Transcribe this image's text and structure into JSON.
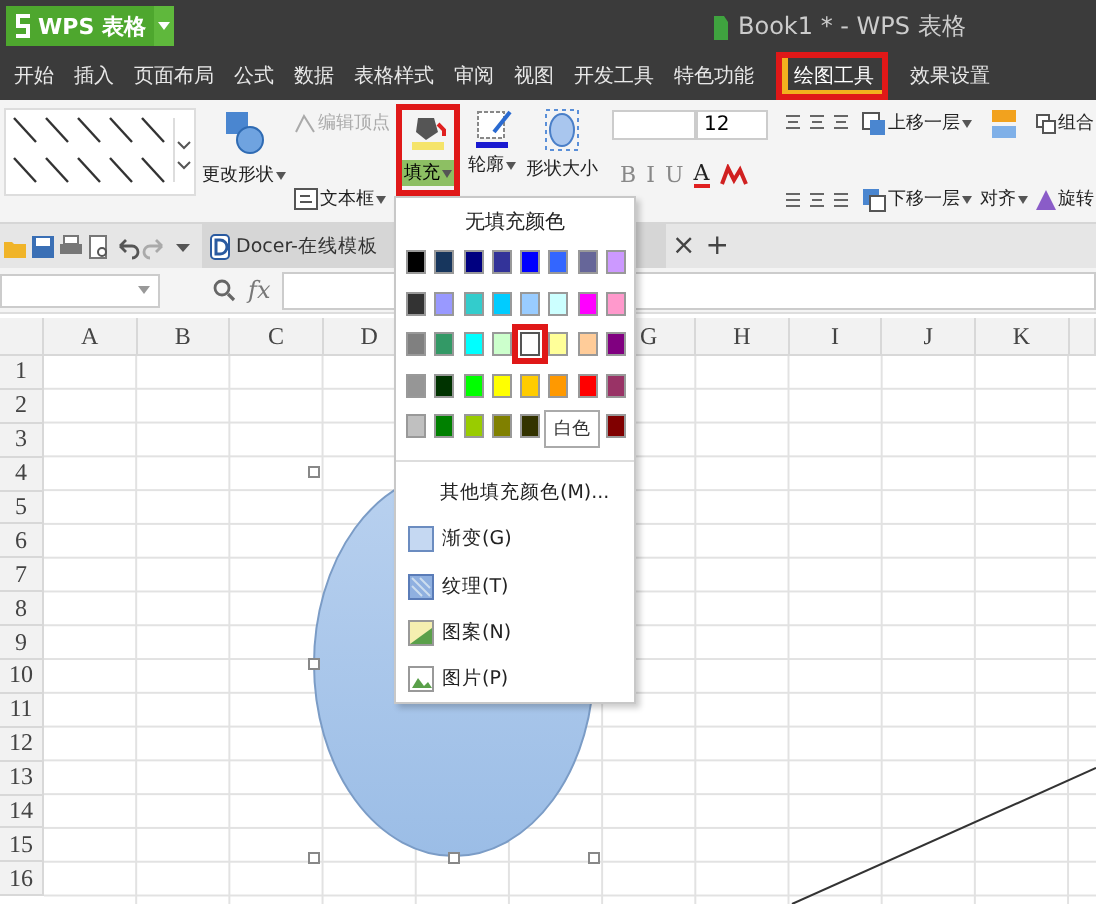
{
  "app_button": {
    "label": "WPS 表格"
  },
  "window": {
    "title": "Book1 * - WPS 表格"
  },
  "menu_tabs": [
    {
      "label": "开始",
      "selected": false,
      "highlighted": false
    },
    {
      "label": "插入",
      "selected": false,
      "highlighted": false
    },
    {
      "label": "页面布局",
      "selected": false,
      "highlighted": false
    },
    {
      "label": "公式",
      "selected": false,
      "highlighted": false
    },
    {
      "label": "数据",
      "selected": false,
      "highlighted": false
    },
    {
      "label": "表格样式",
      "selected": false,
      "highlighted": false
    },
    {
      "label": "审阅",
      "selected": false,
      "highlighted": false
    },
    {
      "label": "视图",
      "selected": false,
      "highlighted": false
    },
    {
      "label": "开发工具",
      "selected": false,
      "highlighted": false
    },
    {
      "label": "特色功能",
      "selected": false,
      "highlighted": false
    },
    {
      "label": "绘图工具",
      "selected": true,
      "highlighted": true
    },
    {
      "label": "效果设置",
      "selected": false,
      "highlighted": false
    }
  ],
  "ribbon": {
    "change_shape": "更改形状",
    "edit_points": {
      "label": "编辑顶点",
      "disabled": true
    },
    "text_box": "文本框",
    "fill": {
      "label": "填充",
      "highlighted": true
    },
    "outline": "轮廓",
    "shape_size": "形状大小",
    "font_size": "12",
    "format_buttons": [
      "B",
      "I",
      "U",
      "A"
    ],
    "bring_forward": "上移一层",
    "send_backward": "下移一层",
    "align": "对齐",
    "group": "组合",
    "rotate": "旋转"
  },
  "doc_tabs": [
    {
      "label": "Docer-在线模板",
      "selected": true
    }
  ],
  "doc_tab_close": "×",
  "new_tab": "+",
  "formula_bar": {
    "fx": "fx"
  },
  "sheet": {
    "columns_left": [
      "A",
      "B",
      "C",
      "D"
    ],
    "columns_right": [
      "G",
      "H",
      "I",
      "J",
      "K"
    ],
    "rows": [
      "1",
      "2",
      "3",
      "4",
      "5",
      "6",
      "7",
      "8",
      "9",
      "10",
      "11",
      "12",
      "13",
      "14",
      "15",
      "16"
    ]
  },
  "fill_menu": {
    "no_fill": "无填充颜色",
    "swatches": [
      [
        {
          "color": "#000000",
          "selected": false
        },
        {
          "color": "#17365d",
          "selected": false
        },
        {
          "color": "#000080",
          "selected": false
        },
        {
          "color": "#333399",
          "selected": false
        },
        {
          "color": "#0000ff",
          "selected": false
        },
        {
          "color": "#3366ff",
          "selected": false
        },
        {
          "color": "#666699",
          "selected": false
        },
        {
          "color": "#cc99ff",
          "selected": false
        }
      ],
      [
        {
          "color": "#333333",
          "selected": false
        },
        {
          "color": "#9999ff",
          "selected": false
        },
        {
          "color": "#33cccc",
          "selected": false
        },
        {
          "color": "#00ccff",
          "selected": false
        },
        {
          "color": "#99ccff",
          "selected": false
        },
        {
          "color": "#ccffff",
          "selected": false
        },
        {
          "color": "#ff00ff",
          "selected": false
        },
        {
          "color": "#ff99cc",
          "selected": false
        }
      ],
      [
        {
          "color": "#808080",
          "selected": false
        },
        {
          "color": "#339966",
          "selected": false
        },
        {
          "color": "#00ffff",
          "selected": false
        },
        {
          "color": "#ccffcc",
          "selected": false
        },
        {
          "color": "#ffffff",
          "selected": true
        },
        {
          "color": "#ffff99",
          "selected": false
        },
        {
          "color": "#ffcc99",
          "selected": false
        },
        {
          "color": "#800080",
          "selected": false
        }
      ],
      [
        {
          "color": "#969696",
          "selected": false
        },
        {
          "color": "#003300",
          "selected": false
        },
        {
          "color": "#00ff00",
          "selected": false
        },
        {
          "color": "#ffff00",
          "selected": false
        },
        {
          "color": "#ffcc00",
          "selected": false
        },
        {
          "color": "#ff9900",
          "selected": false
        },
        {
          "color": "#ff0000",
          "selected": false
        },
        {
          "color": "#993366",
          "selected": false
        }
      ],
      [
        {
          "color": "#c0c0c0",
          "selected": false
        },
        {
          "color": "#008000",
          "selected": false
        },
        {
          "color": "#99cc00",
          "selected": false
        },
        {
          "color": "#808000",
          "selected": false
        },
        {
          "color": "#333300",
          "selected": false
        },
        {
          "color": "#800000",
          "selected": false
        }
      ]
    ],
    "tooltip": "白色",
    "items": [
      {
        "label": "其他填充颜色(M)...",
        "kind": "more"
      },
      {
        "label": "渐变(G)",
        "kind": "gradient"
      },
      {
        "label": "纹理(T)",
        "kind": "texture"
      },
      {
        "label": "图案(N)",
        "kind": "pattern"
      },
      {
        "label": "图片(P)",
        "kind": "picture"
      }
    ]
  }
}
